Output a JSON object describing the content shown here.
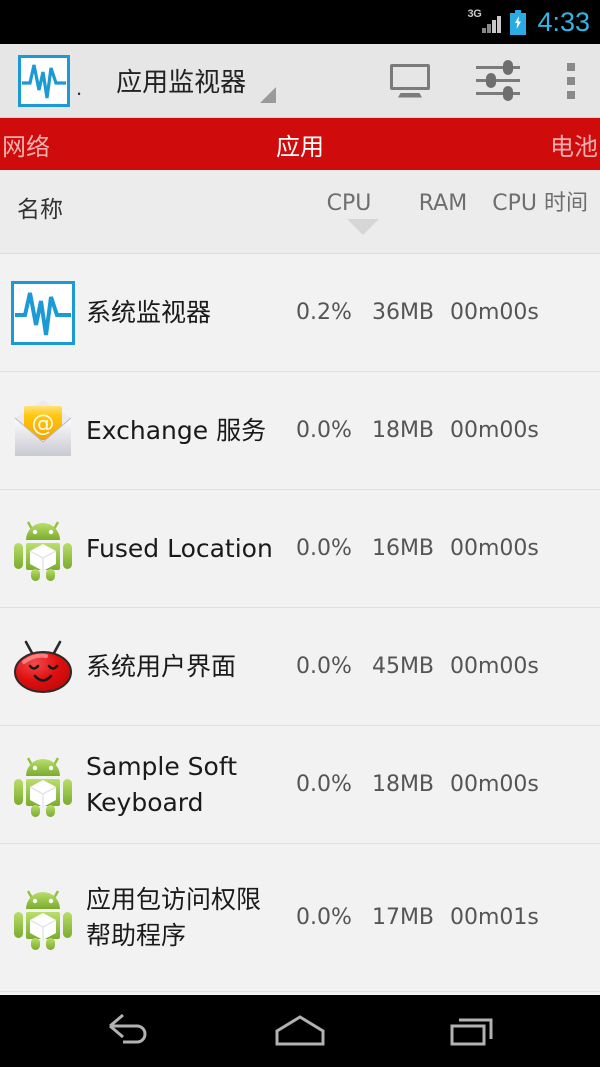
{
  "statusbar": {
    "network_label": "3G",
    "signal_icon": "signal-bars-icon",
    "battery_icon": "battery-charging-icon",
    "clock": "4:33",
    "clock_color": "#33b5e5"
  },
  "actionbar": {
    "logo_icon": "waveform-app-icon",
    "logo_dot": ".",
    "title": "应用监视器",
    "dropdown_icon": "dropdown-caret-icon",
    "actions": [
      {
        "name": "display-monitor",
        "icon": "monitor-icon"
      },
      {
        "name": "settings-sliders",
        "icon": "sliders-icon"
      },
      {
        "name": "overflow-menu",
        "icon": "more-vertical-icon"
      }
    ]
  },
  "tabs": {
    "active_color": "#ffffff",
    "inactive_color": "#f0b0b0",
    "bar_color": "#d00b0b",
    "items": [
      {
        "label": "网络",
        "active": false
      },
      {
        "label": "应用",
        "active": true
      },
      {
        "label": "电池",
        "active": false
      }
    ]
  },
  "columns": {
    "name": "名称",
    "cpu": "CPU",
    "ram": "RAM",
    "cpu_time": "CPU 时间",
    "sort_column": "CPU",
    "sort_direction": "descending",
    "sort_icon": "sort-descending-caret-icon"
  },
  "rows": [
    {
      "icon": "waveform-app-icon",
      "name": "系统监视器",
      "cpu": "0.2%",
      "ram": "36MB",
      "cpu_time": "00m00s"
    },
    {
      "icon": "email-envelope-icon",
      "name": "Exchange 服务",
      "cpu": "0.0%",
      "ram": "18MB",
      "cpu_time": "00m00s"
    },
    {
      "icon": "android-robot-icon",
      "name": "Fused Location",
      "cpu": "0.0%",
      "ram": "16MB",
      "cpu_time": "00m00s"
    },
    {
      "icon": "jellybean-icon",
      "name": "系统用户界面",
      "cpu": "0.0%",
      "ram": "45MB",
      "cpu_time": "00m00s"
    },
    {
      "icon": "android-robot-icon",
      "name": "Sample Soft Keyboard",
      "cpu": "0.0%",
      "ram": "18MB",
      "cpu_time": "00m00s"
    },
    {
      "icon": "android-robot-icon",
      "name": "应用包访问权限帮助程序",
      "cpu": "0.0%",
      "ram": "17MB",
      "cpu_time": "00m01s"
    }
  ],
  "navbar": {
    "buttons": [
      {
        "name": "back",
        "icon": "back-arrow-icon"
      },
      {
        "name": "home",
        "icon": "home-icon"
      },
      {
        "name": "recents",
        "icon": "recent-apps-icon"
      }
    ]
  }
}
